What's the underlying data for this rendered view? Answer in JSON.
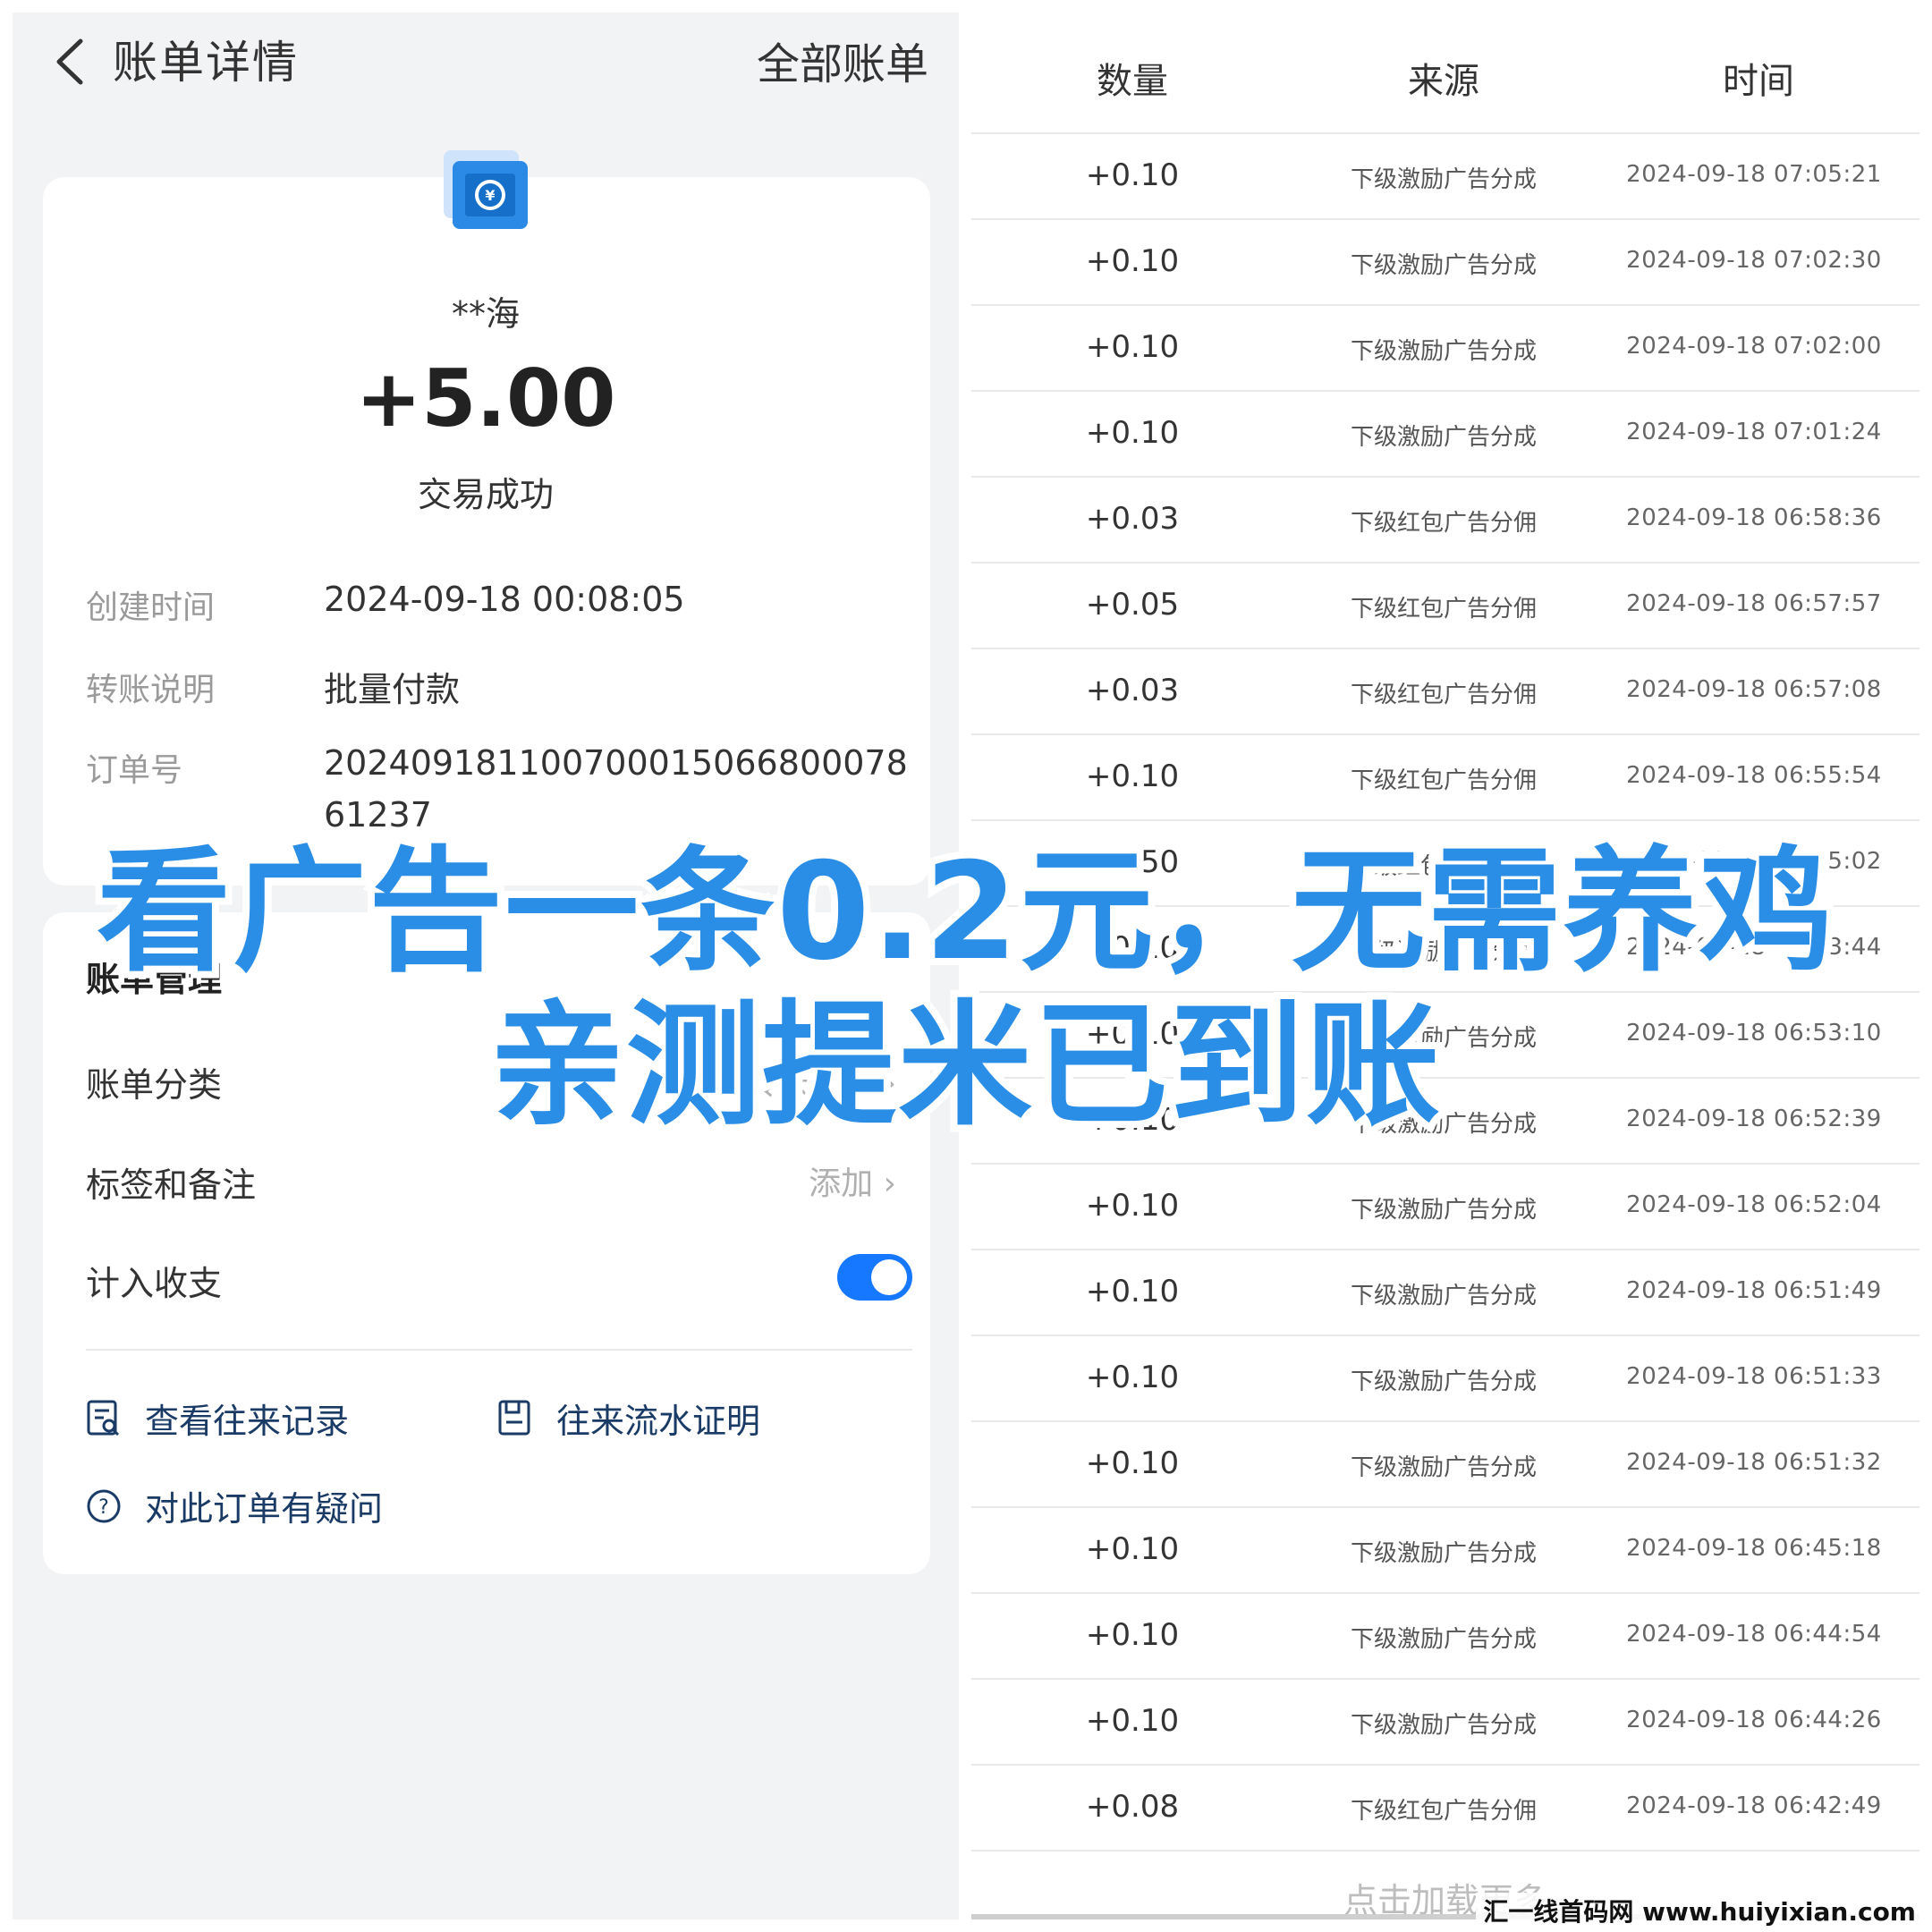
{
  "left": {
    "header": {
      "title": "账单详情",
      "all_bills": "全部账单"
    },
    "detail": {
      "payer": "**海",
      "amount": "+5.00",
      "status": "交易成功",
      "fields": [
        {
          "label": "创建时间",
          "value": "2024-09-18 00:08:05"
        },
        {
          "label": "转账说明",
          "value": "批量付款"
        },
        {
          "label": "订单号",
          "value": "20240918110070001506680007861237"
        }
      ]
    },
    "management": {
      "title": "账单管理",
      "category_label": "账单分类",
      "category_value": "转账红包",
      "tags_label": "标签和备注",
      "tags_action": "添加",
      "include_label": "计入收支",
      "include_on": true,
      "links": {
        "records": "查看往来记录",
        "proof": "往来流水证明",
        "question": "对此订单有疑问"
      }
    },
    "accent_color": "#1677ff"
  },
  "right": {
    "columns": [
      "数量",
      "来源",
      "时间"
    ],
    "rows": [
      {
        "amount": "+0.10",
        "source": "下级激励广告分成",
        "time": "2024-09-18 07:05:21"
      },
      {
        "amount": "+0.10",
        "source": "下级激励广告分成",
        "time": "2024-09-18 07:02:30"
      },
      {
        "amount": "+0.10",
        "source": "下级激励广告分成",
        "time": "2024-09-18 07:02:00"
      },
      {
        "amount": "+0.10",
        "source": "下级激励广告分成",
        "time": "2024-09-18 07:01:24"
      },
      {
        "amount": "+0.03",
        "source": "下级红包广告分佣",
        "time": "2024-09-18 06:58:36"
      },
      {
        "amount": "+0.05",
        "source": "下级红包广告分佣",
        "time": "2024-09-18 06:57:57"
      },
      {
        "amount": "+0.03",
        "source": "下级红包广告分佣",
        "time": "2024-09-18 06:57:08"
      },
      {
        "amount": "+0.10",
        "source": "下级红包广告分佣",
        "time": "2024-09-18 06:55:54"
      },
      {
        "amount": "+0.50",
        "source": "下级红包广告分佣",
        "time": "2024-09-18 06:55:02"
      },
      {
        "amount": "+0.10",
        "source": "下级激励广告分成",
        "time": "2024-09-18 06:53:44"
      },
      {
        "amount": "+0.10",
        "source": "下级激励广告分成",
        "time": "2024-09-18 06:53:10"
      },
      {
        "amount": "+0.10",
        "source": "下级激励广告分成",
        "time": "2024-09-18 06:52:39"
      },
      {
        "amount": "+0.10",
        "source": "下级激励广告分成",
        "time": "2024-09-18 06:52:04"
      },
      {
        "amount": "+0.10",
        "source": "下级激励广告分成",
        "time": "2024-09-18 06:51:49"
      },
      {
        "amount": "+0.10",
        "source": "下级激励广告分成",
        "time": "2024-09-18 06:51:33"
      },
      {
        "amount": "+0.10",
        "source": "下级激励广告分成",
        "time": "2024-09-18 06:51:32"
      },
      {
        "amount": "+0.10",
        "source": "下级激励广告分成",
        "time": "2024-09-18 06:45:18"
      },
      {
        "amount": "+0.10",
        "source": "下级激励广告分成",
        "time": "2024-09-18 06:44:54"
      },
      {
        "amount": "+0.10",
        "source": "下级激励广告分成",
        "time": "2024-09-18 06:44:26"
      },
      {
        "amount": "+0.08",
        "source": "下级红包广告分佣",
        "time": "2024-09-18 06:42:49"
      }
    ],
    "load_more": "点击加载更多"
  },
  "overlay": {
    "line1": "看广告一条0.2元，无需养鸡",
    "line2": "亲测提米已到账",
    "color": "#2a8ee6"
  },
  "watermark": "汇一线首码网 www.huiyixian.com"
}
